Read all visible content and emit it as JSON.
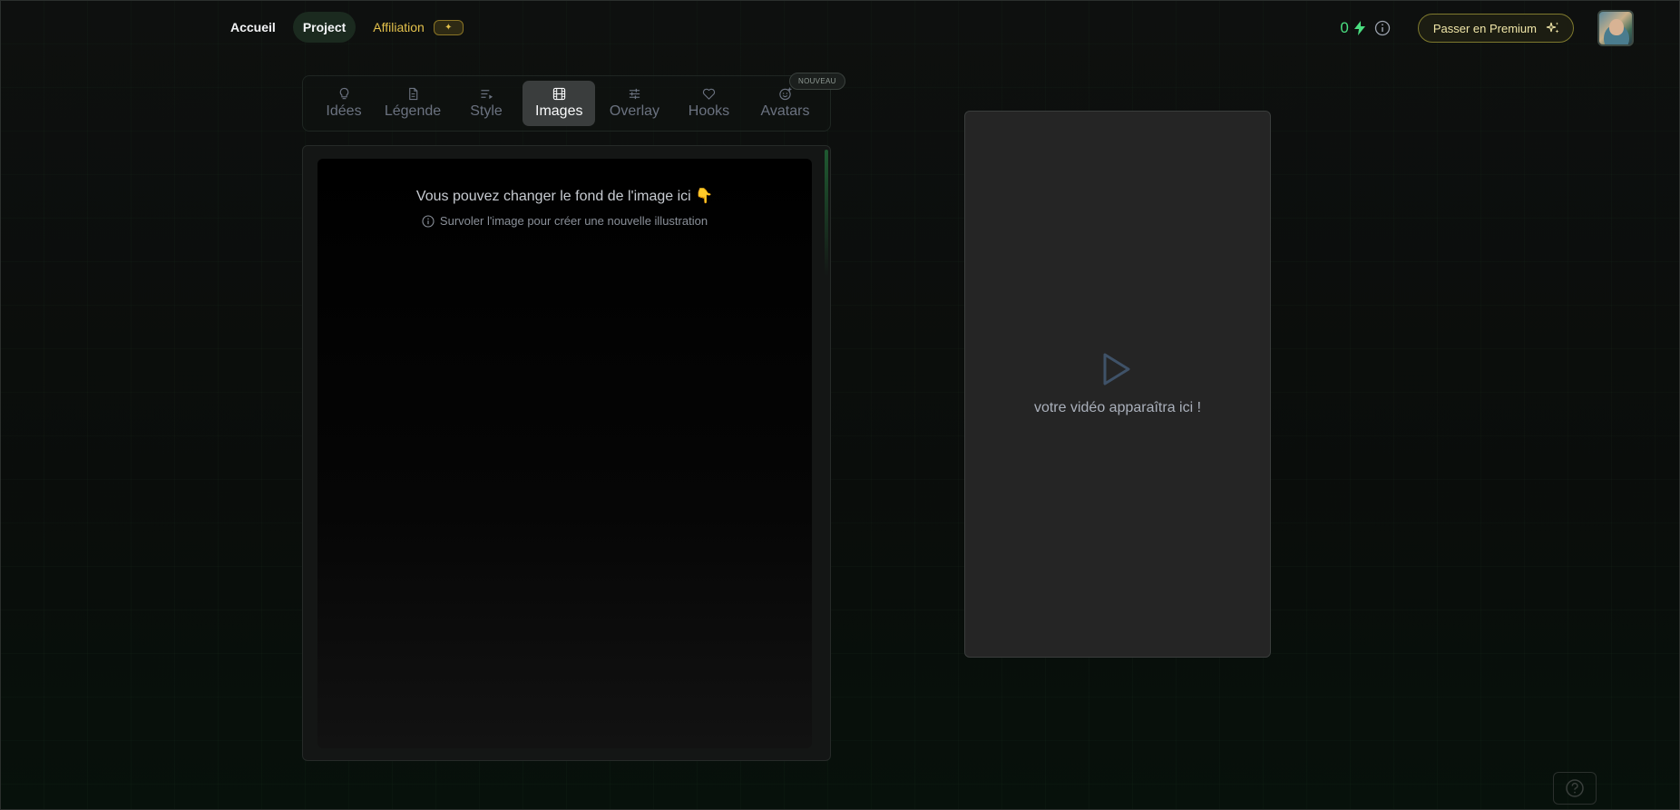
{
  "nav": {
    "links": [
      {
        "label": "Accueil"
      },
      {
        "label": "Project"
      },
      {
        "label": "Affiliation",
        "badge": "✦"
      }
    ],
    "credits": "0",
    "premium_label": "Passer en Premium"
  },
  "tabs": [
    {
      "label": "Idées",
      "icon": "lightbulb-icon"
    },
    {
      "label": "Légende",
      "icon": "document-icon"
    },
    {
      "label": "Style",
      "icon": "list-play-icon"
    },
    {
      "label": "Images",
      "icon": "film-icon",
      "active": true
    },
    {
      "label": "Overlay",
      "icon": "sliders-icon"
    },
    {
      "label": "Hooks",
      "icon": "heart-icon"
    },
    {
      "label": "Avatars",
      "icon": "smiley-plus-icon"
    }
  ],
  "badge_nouveau": "NOUVEAU",
  "image_panel": {
    "title": "Vous pouvez changer le fond de l'image ici 👇",
    "hint": "Survoler l'image pour créer une nouvelle illustration"
  },
  "video": {
    "placeholder": "votre vidéo apparaîtra ici !"
  },
  "colors": {
    "accent_green": "#4ade80",
    "accent_gold": "#e3c14c",
    "play_icon": "#3f5268"
  }
}
